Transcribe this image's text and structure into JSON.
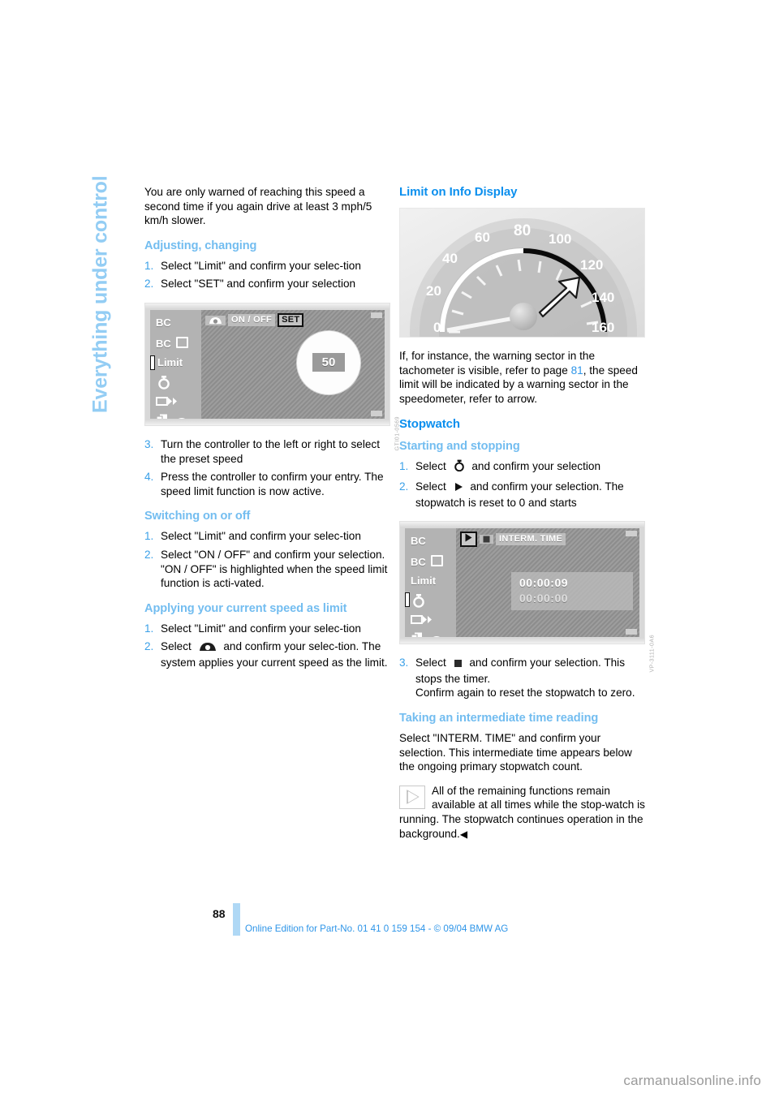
{
  "chapter_tab": {
    "label": "Everything under control"
  },
  "left_column": {
    "intro_paragraph": "You are only warned of reaching this speed a second time if you again drive at least 3 mph/5 km/h slower.",
    "section_adjusting": {
      "heading": "Adjusting, changing",
      "steps": [
        {
          "num": "1.",
          "text": "Select \"Limit\" and confirm your selec-tion"
        },
        {
          "num": "2.",
          "text": "Select \"SET\" and confirm your selection"
        }
      ]
    },
    "figure_limit_set": {
      "menu_items": [
        "BC",
        "BC",
        "Limit",
        "stopwatch-icon",
        "arrow-box-icon",
        "pages-car-icon"
      ],
      "selected_menu_item": "Limit",
      "topbar": {
        "icon": "speed-car-icon",
        "on_off_label": "ON / OFF",
        "set_label": "SET"
      },
      "value": "50",
      "figure_id": "GTI01-0569"
    },
    "steps_after_figure": [
      {
        "num": "3.",
        "text": "Turn the controller to the left or right to select the preset speed"
      },
      {
        "num": "4.",
        "text": "Press the controller to confirm your entry. The speed limit function is now active."
      }
    ],
    "section_switching": {
      "heading": "Switching on or off",
      "steps": [
        {
          "num": "1.",
          "text": "Select \"Limit\" and confirm your selec-tion"
        },
        {
          "num": "2.",
          "text": "Select \"ON / OFF\" and confirm your selection. \"ON / OFF\" is highlighted when the speed limit function is acti-vated."
        }
      ]
    },
    "section_applying": {
      "heading": "Applying your current speed as limit",
      "steps": [
        {
          "num": "1.",
          "text": "Select \"Limit\" and confirm your selec-tion"
        },
        {
          "num": "2.",
          "text_before": "Select",
          "icon": "speed-car-icon",
          "text_after": "and confirm your selec-tion. The system applies your current speed as the limit."
        }
      ]
    }
  },
  "right_column": {
    "section_limit_info": {
      "heading": "Limit on Info Display",
      "paragraph_before_ref": "If, for instance, the warning sector in the tachometer is visible, refer to page ",
      "page_ref": "81",
      "paragraph_after_ref": ", the speed limit will be indicated by a warning sector in the speedometer, refer to arrow."
    },
    "figure_speedometer": {
      "tick_labels": [
        "0",
        "20",
        "40",
        "60",
        "80",
        "100",
        "120",
        "140",
        "160"
      ],
      "needle_value": "0",
      "warning_sector_start": "80",
      "figure_id": "VP-3412-0A1"
    },
    "section_stopwatch": {
      "heading": "Stopwatch",
      "sub_starting": {
        "heading": "Starting and stopping",
        "steps": [
          {
            "num": "1.",
            "text_before": "Select",
            "icon": "stopwatch-icon",
            "text_after": "and confirm your selection"
          },
          {
            "num": "2.",
            "text_before": "Select",
            "icon": "play-icon",
            "text_after": "and confirm your selection. The stopwatch is reset to 0 and starts"
          }
        ]
      },
      "figure_stopwatch": {
        "menu_items": [
          "BC",
          "BC",
          "Limit",
          "stopwatch-icon",
          "arrow-box-icon",
          "pages-car-icon"
        ],
        "selected_menu_item": "stopwatch-icon",
        "topbar": {
          "play_label": "play-icon",
          "stop_label": "stop-icon",
          "interm_label": "INTERM. TIME"
        },
        "primary_time": "00:00:09",
        "intermediate_time": "00:00:00",
        "figure_id": "VP-3111-0A6"
      },
      "step_three": {
        "num": "3.",
        "text_before": "Select",
        "icon": "stop-icon",
        "text_after": "and confirm your selection. This stops the timer."
      },
      "step_three_line2": "Confirm again to reset the stopwatch to zero.",
      "sub_intermediate": {
        "heading": "Taking an intermediate time reading",
        "paragraph": "Select \"INTERM. TIME\" and confirm your selection. This intermediate time appears below the ongoing primary stopwatch count.",
        "note": "All of the remaining functions remain available at all times while the stop-watch is running. The stopwatch continues operation in the background.",
        "note_end_mark": "◀"
      }
    }
  },
  "footer": {
    "page_number": "88",
    "edition_text": "Online Edition for Part-No. 01 41 0 159 154 - © 09/04 BMW AG"
  },
  "watermark": {
    "text": "carmanualsonline.info"
  },
  "colors": {
    "main_heading": "#0B8FEE",
    "sub_heading": "#73BDF0",
    "chapter_tab": "#93CDF4",
    "list_number": "#3AA0E8",
    "footer_text": "#2E95E8",
    "footer_bar": "#AFD8F5"
  }
}
